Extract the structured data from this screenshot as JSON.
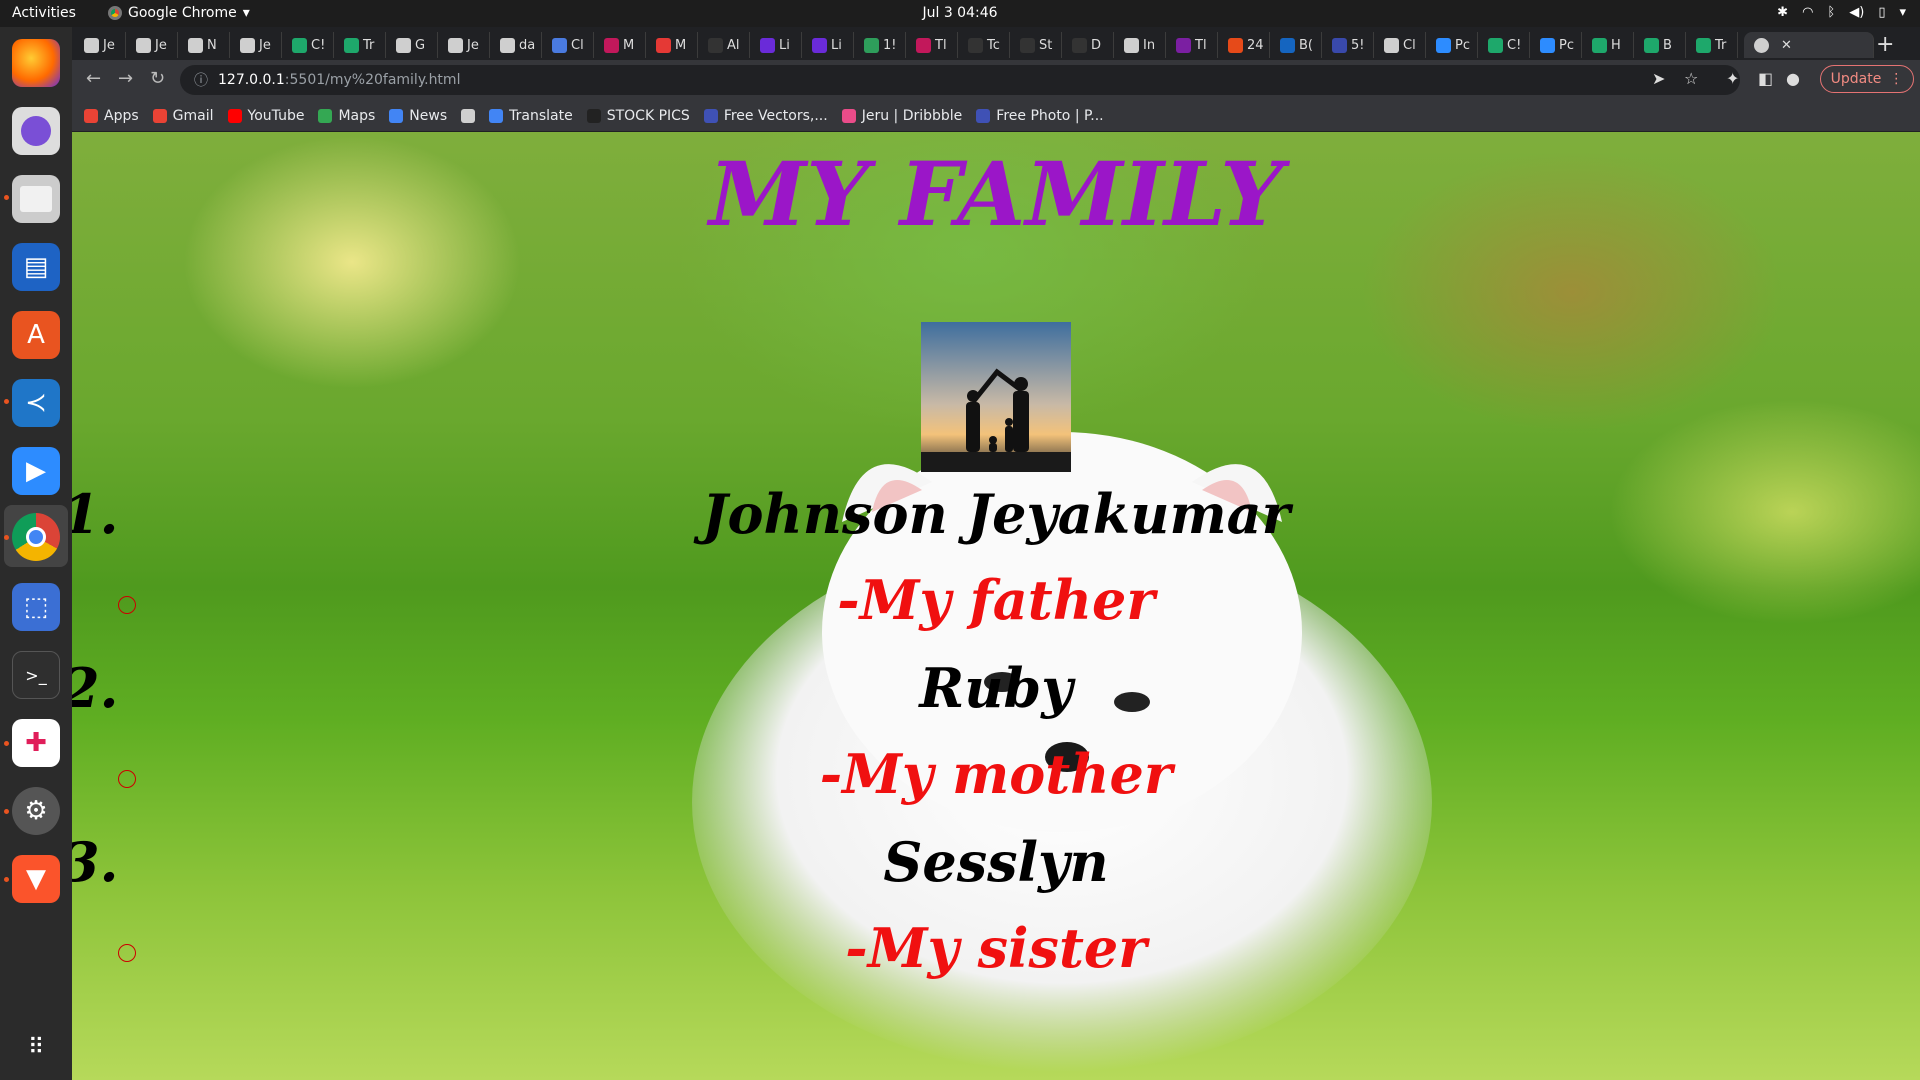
{
  "topbar": {
    "activities": "Activities",
    "app_name": "Google Chrome",
    "clock": "Jul 3  04:46"
  },
  "tabs": [
    {
      "label": "Je",
      "color": "#cfcfcf"
    },
    {
      "label": "Je",
      "color": "#cfcfcf"
    },
    {
      "label": "N",
      "color": "#cfcfcf"
    },
    {
      "label": "Je",
      "color": "#cfcfcf"
    },
    {
      "label": "C!",
      "color": "#1ea86b"
    },
    {
      "label": "Tr",
      "color": "#1ea86b"
    },
    {
      "label": "G",
      "color": "#cfcfcf"
    },
    {
      "label": "Je",
      "color": "#cfcfcf"
    },
    {
      "label": "da",
      "color": "#cfcfcf"
    },
    {
      "label": "Cl",
      "color": "#4a7be0"
    },
    {
      "label": "M",
      "color": "#c2185b"
    },
    {
      "label": "M",
      "color": "#e53935"
    },
    {
      "label": "Al",
      "color": "#333333"
    },
    {
      "label": "Li",
      "color": "#6a2bd9"
    },
    {
      "label": "Li",
      "color": "#6a2bd9"
    },
    {
      "label": "1!",
      "color": "#2e9e5b"
    },
    {
      "label": "Tl",
      "color": "#c2185b"
    },
    {
      "label": "Tc",
      "color": "#333333"
    },
    {
      "label": "St",
      "color": "#333333"
    },
    {
      "label": "D",
      "color": "#333333"
    },
    {
      "label": "In",
      "color": "#cfcfcf"
    },
    {
      "label": "Tl",
      "color": "#7b1fa2"
    },
    {
      "label": "24",
      "color": "#e64a19"
    },
    {
      "label": "B(",
      "color": "#1565c0"
    },
    {
      "label": "5!",
      "color": "#3949ab"
    },
    {
      "label": "Cl",
      "color": "#cfcfcf"
    },
    {
      "label": "Pc",
      "color": "#2d8cff"
    },
    {
      "label": "C!",
      "color": "#1ea86b"
    },
    {
      "label": "Pc",
      "color": "#2d8cff"
    },
    {
      "label": "H",
      "color": "#1ea86b"
    },
    {
      "label": "B",
      "color": "#1ea86b"
    },
    {
      "label": "Tr",
      "color": "#1ea86b"
    }
  ],
  "omnibox": {
    "host": "127.0.0.1",
    "rest": ":5501/my%20family.html"
  },
  "update_label": "Update",
  "bookmarks": [
    {
      "label": "Apps",
      "color": "#ea4335"
    },
    {
      "label": "Gmail",
      "color": "#ea4335"
    },
    {
      "label": "YouTube",
      "color": "#ff0000"
    },
    {
      "label": "Maps",
      "color": "#34a853"
    },
    {
      "label": "News",
      "color": "#4285f4"
    },
    {
      "label": "",
      "color": "#cfcfcf"
    },
    {
      "label": "Translate",
      "color": "#4285f4"
    },
    {
      "label": "STOCK PICS",
      "color": "#222222"
    },
    {
      "label": "Free Vectors,...",
      "color": "#3f51b5"
    },
    {
      "label": "Jeru | Dribbble",
      "color": "#ea4c89"
    },
    {
      "label": "Free Photo | P...",
      "color": "#3f51b5"
    }
  ],
  "page": {
    "title": "MY FAMILY",
    "members": [
      {
        "number": "1.",
        "name": "Johnson Jeyakumar",
        "relation": "-My father"
      },
      {
        "number": "2.",
        "name": "Ruby",
        "relation": "-My mother"
      },
      {
        "number": "3.",
        "name": "Sesslyn",
        "relation": "-My sister"
      }
    ]
  },
  "colors": {
    "title": "#9b16c8",
    "relation": "#f01010",
    "name": "#000000"
  }
}
